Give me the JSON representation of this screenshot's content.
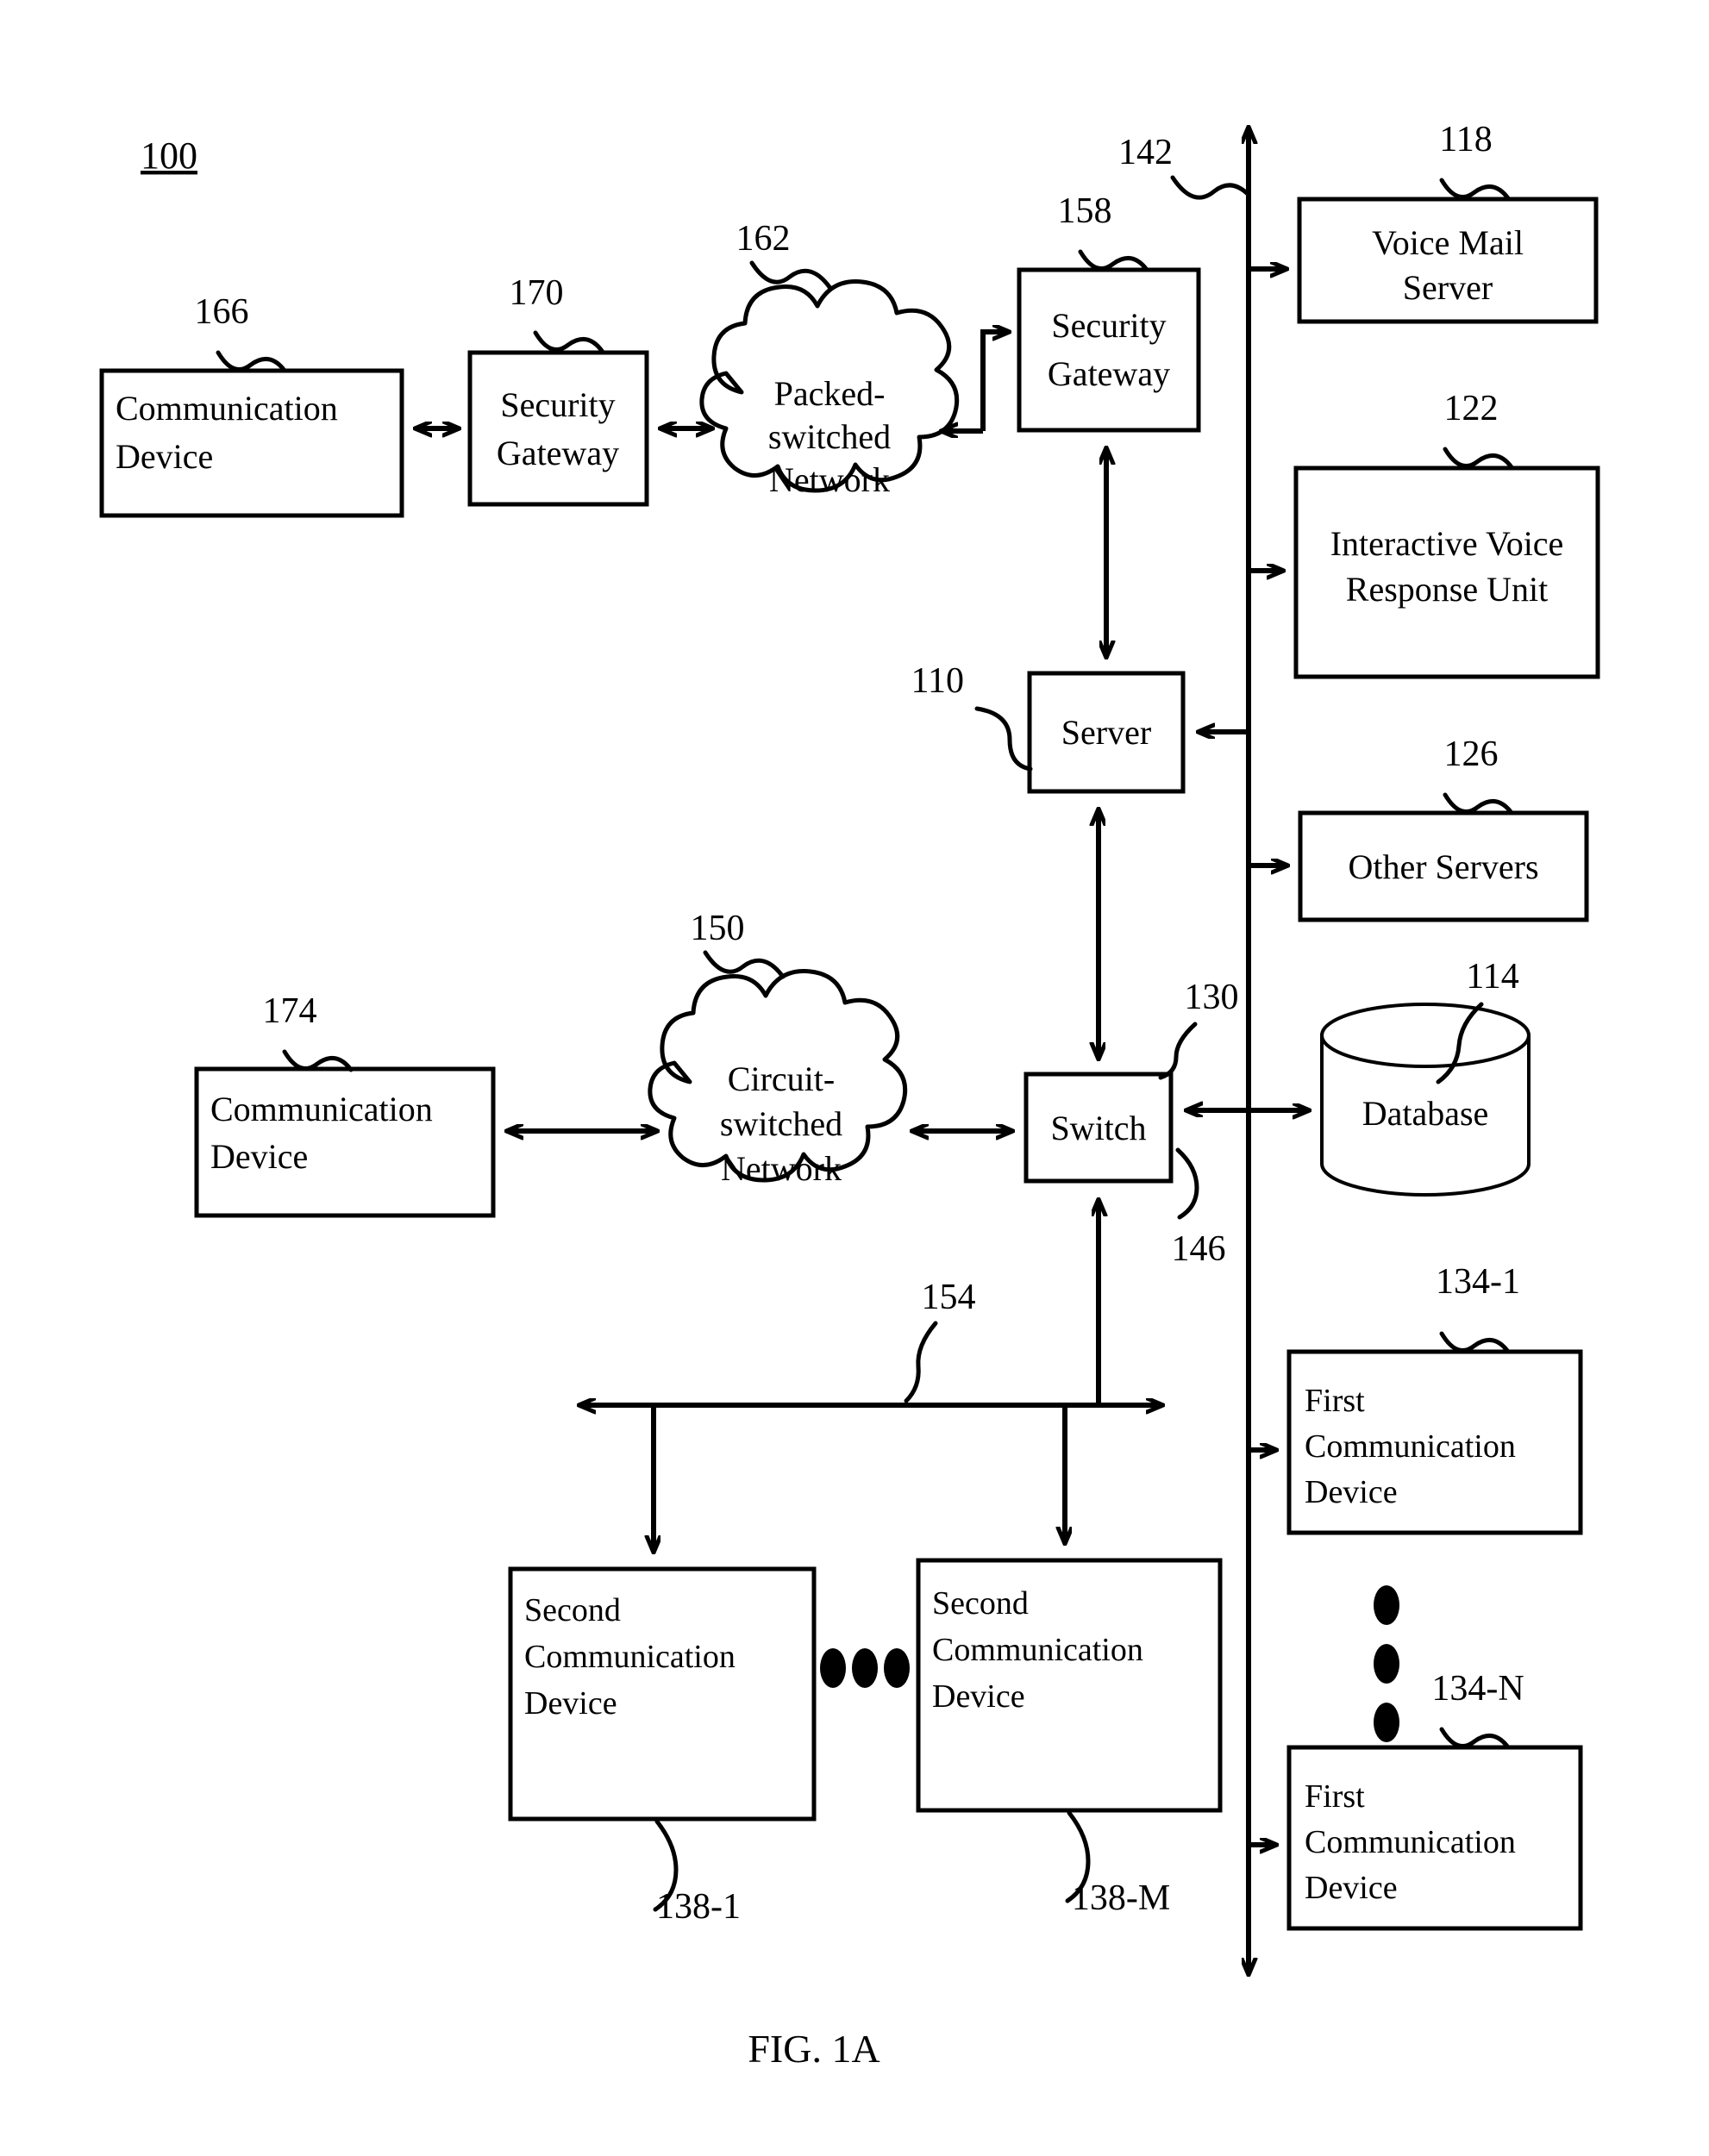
{
  "figure": {
    "title_number": "100",
    "caption": "FIG. 1A"
  },
  "nodes": {
    "comm_device_top": {
      "label_line1": "Communication",
      "label_line2": "Device",
      "ref": "166"
    },
    "security_gateway_left": {
      "label_line1": "Security",
      "label_line2": "Gateway",
      "ref": "170"
    },
    "packet_network": {
      "label_line1": "Packed-",
      "label_line2": "switched",
      "label_line3": "Network",
      "ref": "162"
    },
    "security_gateway_right": {
      "label_line1": "Security",
      "label_line2": "Gateway",
      "ref": "158"
    },
    "voice_mail_server": {
      "label_line1": "Voice Mail",
      "label_line2": "Server",
      "ref": "118"
    },
    "ivr_unit": {
      "label_line1": "Interactive Voice",
      "label_line2": "Response Unit",
      "ref": "122"
    },
    "server": {
      "label": "Server",
      "ref": "110"
    },
    "other_servers": {
      "label": "Other Servers",
      "ref": "126"
    },
    "database": {
      "label": "Database",
      "ref": "114"
    },
    "comm_device_bottom": {
      "label_line1": "Communication",
      "label_line2": "Device",
      "ref": "174"
    },
    "circuit_network": {
      "label_line1": "Circuit-",
      "label_line2": "switched",
      "label_line3": "Network",
      "ref": "150"
    },
    "switch": {
      "label": "Switch",
      "ref": "130"
    },
    "second_comm_device_1": {
      "label_line1": "Second",
      "label_line2": "Communication",
      "label_line3": "Device",
      "ref": "138-1"
    },
    "second_comm_device_m": {
      "label_line1": "Second",
      "label_line2": "Communication",
      "label_line3": "Device",
      "ref": "138-M"
    },
    "first_comm_device_1": {
      "label_line1": "First",
      "label_line2": "Communication",
      "label_line3": "Device",
      "ref": "134-1"
    },
    "first_comm_device_n": {
      "label_line1": "First",
      "label_line2": "Communication",
      "label_line3": "Device",
      "ref": "134-N"
    }
  },
  "links": {
    "bus_vertical": {
      "ref": "142"
    },
    "bus_switch_database": {
      "ref": "146"
    },
    "bus_horizontal": {
      "ref": "154"
    }
  },
  "colors": {
    "line": "#000000",
    "fill": "#ffffff",
    "text": "#000000"
  }
}
